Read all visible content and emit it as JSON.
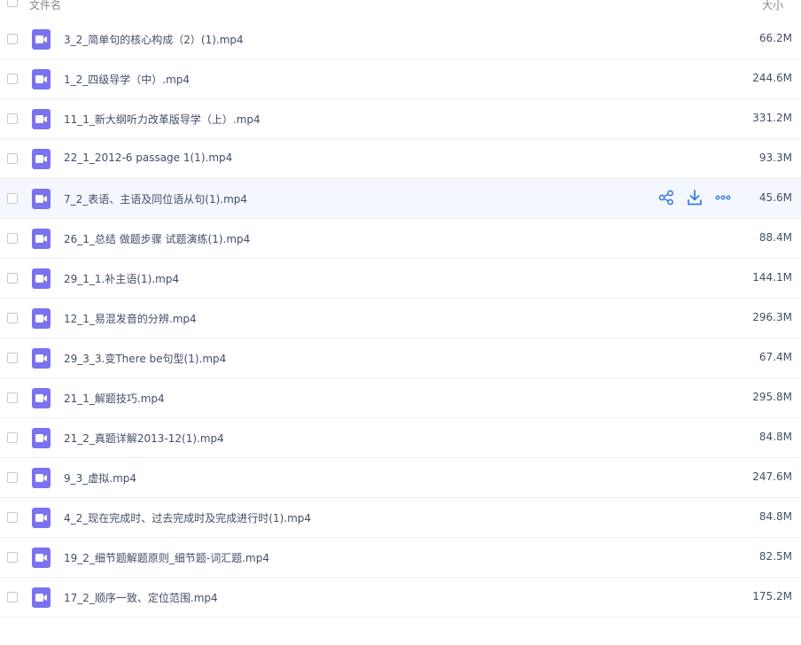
{
  "header": {
    "name_label": "文件名",
    "size_label": "大小"
  },
  "colors": {
    "file_icon": "#7a72f0",
    "action_icon": "#3b7ce8",
    "hover_row": "#f4f7fd"
  },
  "files": [
    {
      "name": "3_2_简单句的核心构成（2）(1).mp4",
      "size": "66.2M",
      "icon": "video-file-icon"
    },
    {
      "name": "1_2_四级导学（中）.mp4",
      "size": "244.6M",
      "icon": "video-file-icon"
    },
    {
      "name": "11_1_新大纲听力改革版导学（上）.mp4",
      "size": "331.2M",
      "icon": "video-file-icon"
    },
    {
      "name": "22_1_2012-6 passage 1(1).mp4",
      "size": "93.3M",
      "icon": "video-file-icon"
    },
    {
      "name": "7_2_表语、主语及同位语从句(1).mp4",
      "size": "45.6M",
      "icon": "video-file-icon",
      "hovered": true
    },
    {
      "name": "26_1_总结 做题步骤 试题演练(1).mp4",
      "size": "88.4M",
      "icon": "video-file-icon"
    },
    {
      "name": "29_1_1.补主语(1).mp4",
      "size": "144.1M",
      "icon": "video-file-icon"
    },
    {
      "name": "12_1_易混发音的分辨.mp4",
      "size": "296.3M",
      "icon": "video-file-icon"
    },
    {
      "name": "29_3_3.变There be句型(1).mp4",
      "size": "67.4M",
      "icon": "video-file-icon"
    },
    {
      "name": "21_1_解题技巧.mp4",
      "size": "295.8M",
      "icon": "video-file-icon"
    },
    {
      "name": "21_2_真题详解2013-12(1).mp4",
      "size": "84.8M",
      "icon": "video-file-icon"
    },
    {
      "name": "9_3_虚拟.mp4",
      "size": "247.6M",
      "icon": "video-file-icon"
    },
    {
      "name": "4_2_现在完成时、过去完成时及完成进行时(1).mp4",
      "size": "84.8M",
      "icon": "video-file-icon"
    },
    {
      "name": "19_2_细节题解题原则_细节题-词汇题.mp4",
      "size": "82.5M",
      "icon": "video-file-icon"
    },
    {
      "name": "17_2_顺序一致、定位范围.mp4",
      "size": "175.2M",
      "icon": "video-file-icon"
    }
  ],
  "row_actions": [
    {
      "name": "share-icon"
    },
    {
      "name": "download-icon"
    },
    {
      "name": "more-icon"
    }
  ]
}
